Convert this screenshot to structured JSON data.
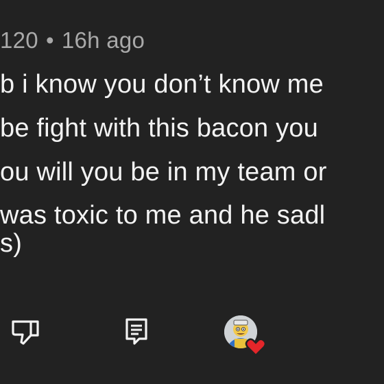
{
  "comment": {
    "author_fragment": "120",
    "separator": "•",
    "time": "16h ago",
    "lines": [
      "b i know you don’t know me",
      "be fight with this bacon you",
      "ou will you be in my team or",
      "was toxic to me and he sadl",
      "s)"
    ]
  },
  "actions": {
    "dislike_icon": "thumbs-down-icon",
    "reply_icon": "reply-icon",
    "creator_heart_icon": "creator-avatar-heart-icon"
  },
  "colors": {
    "background": "#222222",
    "text": "#f3f3f3",
    "meta_text": "#a9a9a9",
    "heart": "#e3262a"
  }
}
